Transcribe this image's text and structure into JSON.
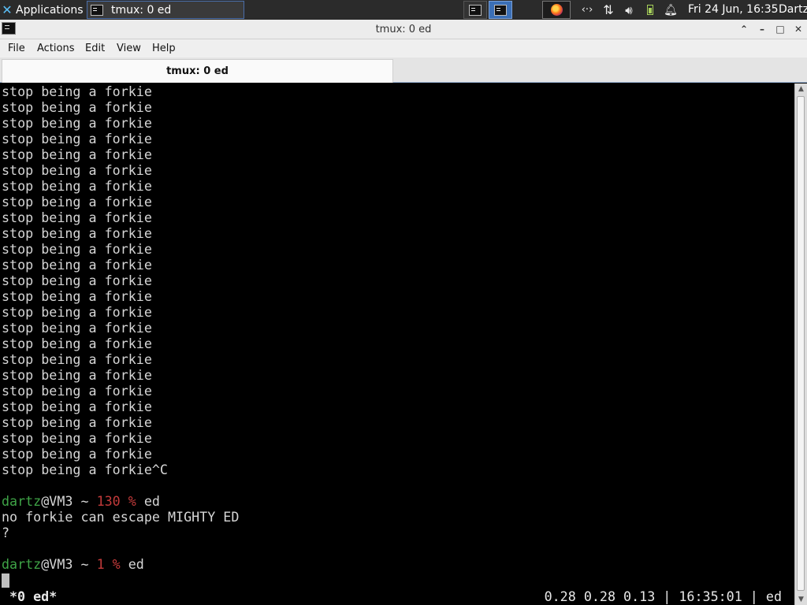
{
  "panel": {
    "applications_label": "Applications",
    "task_title": "tmux: 0 ed",
    "clock": "Fri 24 Jun, 16:35",
    "user": "Dartz"
  },
  "window": {
    "title": "tmux: 0 ed",
    "controls": {
      "shade": "⌃",
      "minimize": "–",
      "maximize": "□",
      "close": "✕"
    }
  },
  "menubar": [
    "File",
    "Actions",
    "Edit",
    "View",
    "Help"
  ],
  "tab": {
    "label": "tmux: 0 ed"
  },
  "terminal": {
    "repeated_line": "stop being a forkie",
    "last_interrupt_line": "stop being a forkie^C",
    "prompt1": {
      "user": "dartz",
      "host": "@VM3 ~ ",
      "status": "130 %",
      "cmd": " ed"
    },
    "output1": "no forkie can escape MIGHTY ED",
    "output2": "?",
    "prompt2": {
      "user": "dartz",
      "host": "@VM3 ~ ",
      "status": "1 %",
      "cmd": " ed"
    }
  },
  "tmux_status": {
    "window": "*0 ed*",
    "right": "0.28 0.28 0.13 | 16:35:01 | ed"
  },
  "colors": {
    "prompt_user": "#3fa447",
    "prompt_status": "#c23a3a",
    "panel_bg": "#2b2b2b",
    "active_workspace": "#3b6fb6"
  }
}
